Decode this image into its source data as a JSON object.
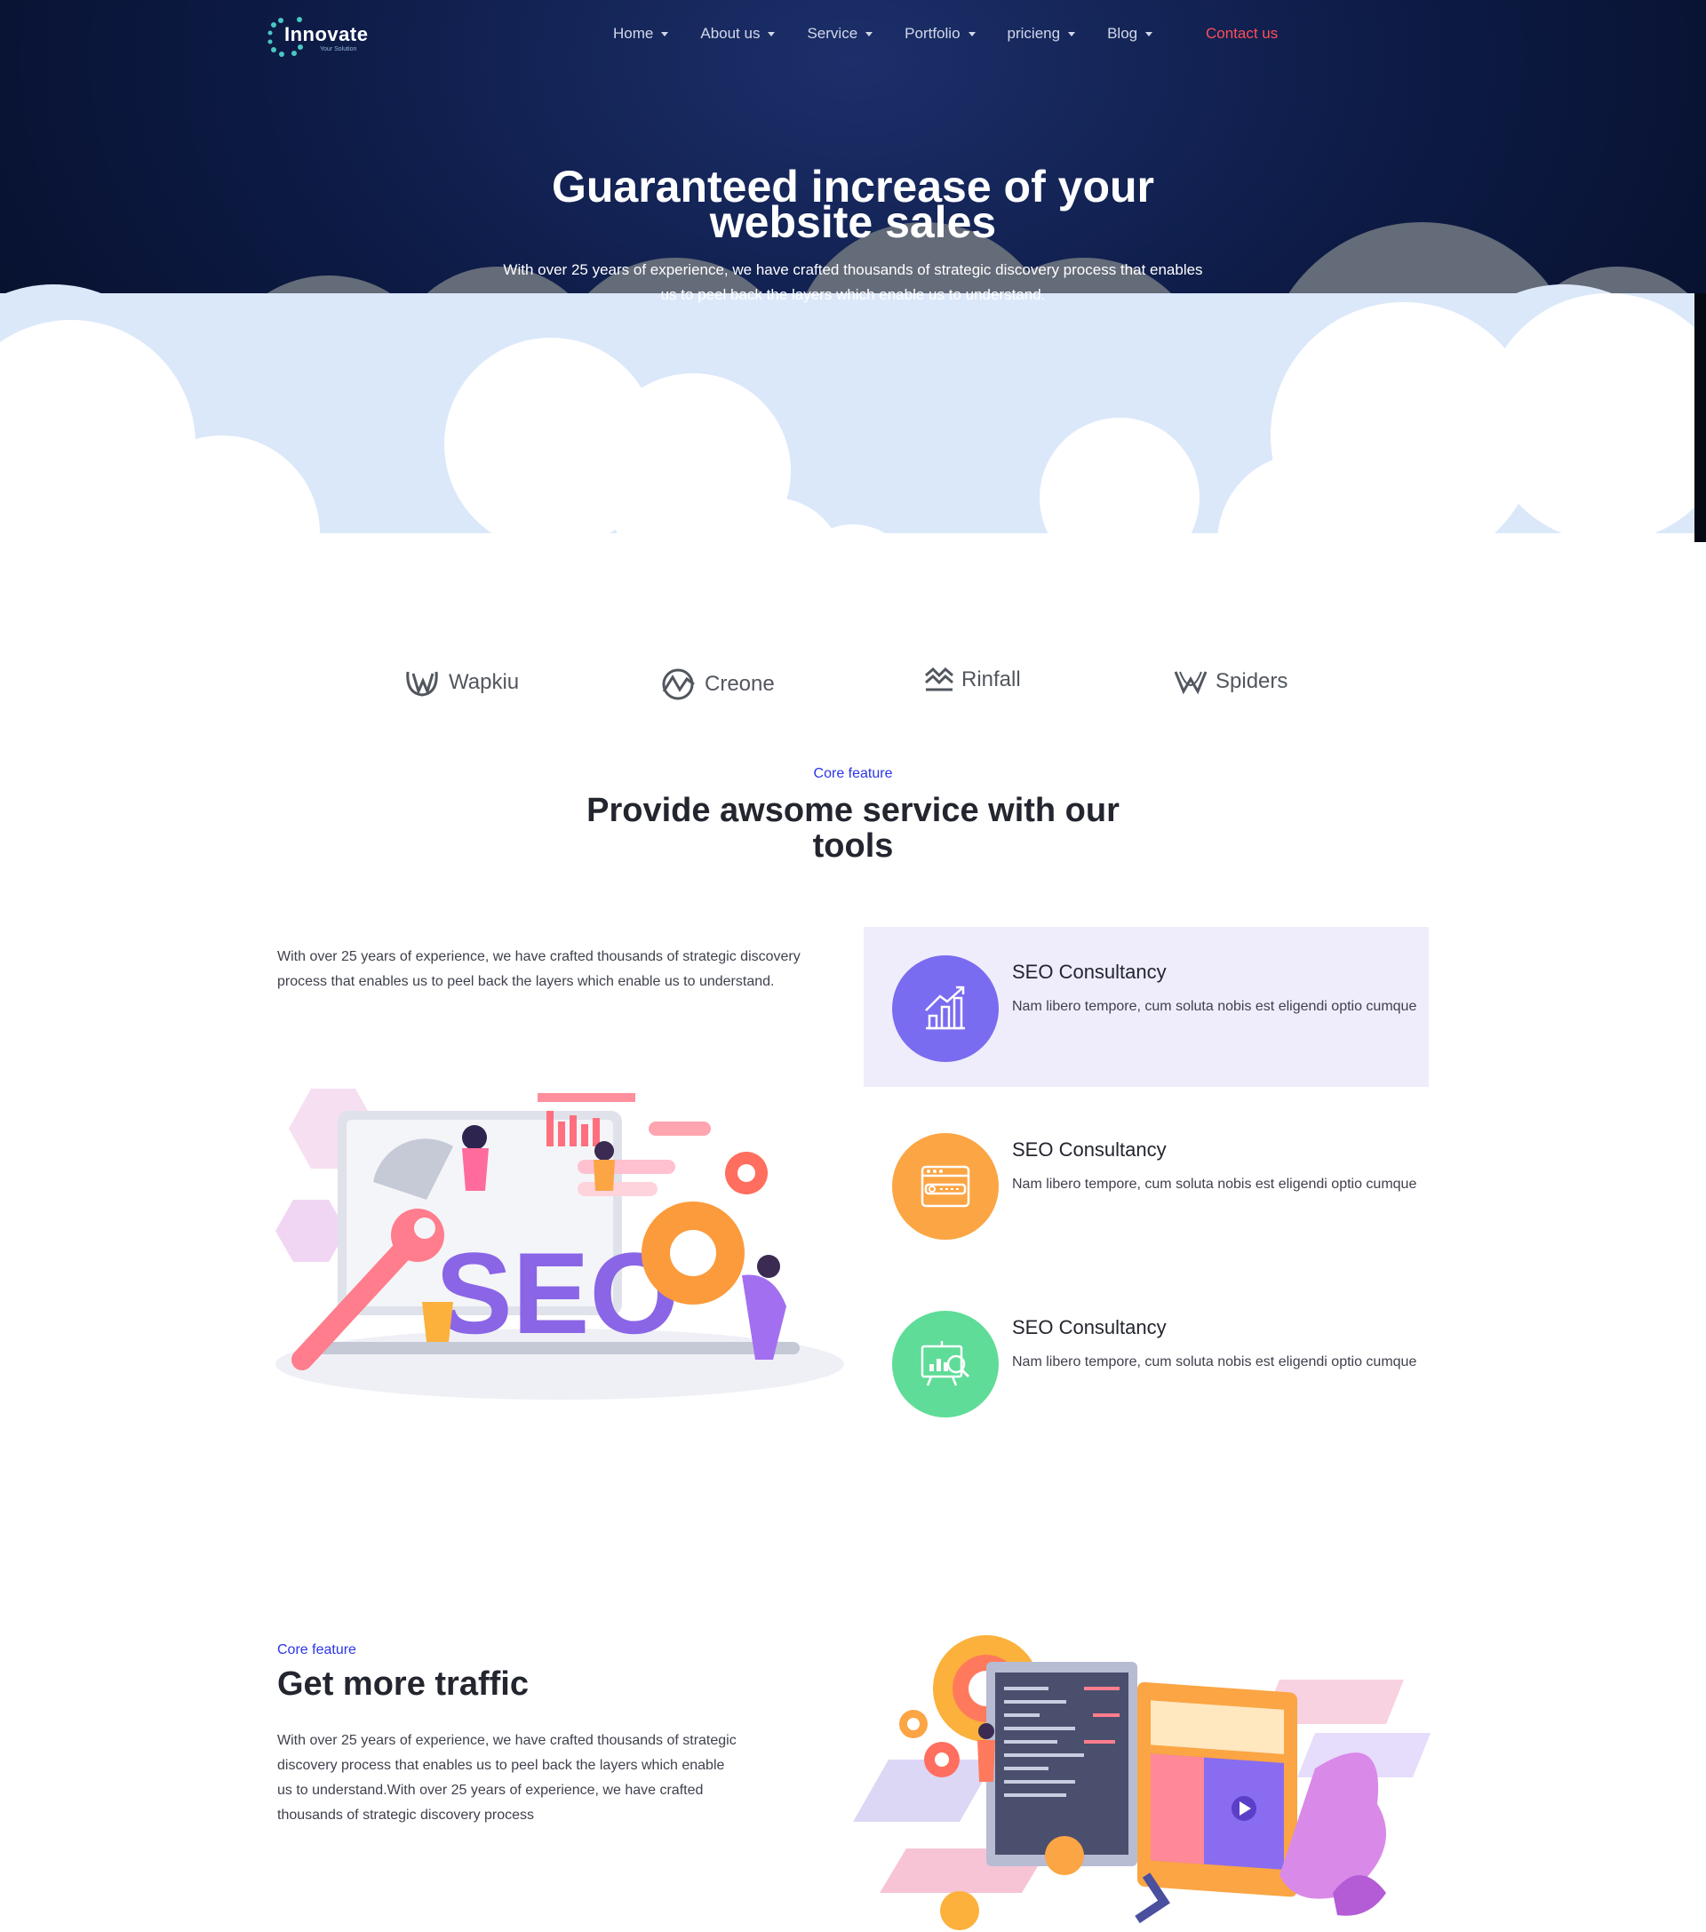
{
  "nav": {
    "logo_text": "Innovate",
    "logo_sub": "Your Solution",
    "items": [
      {
        "label": "Home"
      },
      {
        "label": "About us"
      },
      {
        "label": "Service"
      },
      {
        "label": "Portfolio"
      },
      {
        "label": "pricieng"
      },
      {
        "label": "Blog"
      }
    ],
    "contact": "Contact us"
  },
  "hero": {
    "title_line1": "Guaranteed increase of your",
    "title_line2": "website sales",
    "subtitle_line1": "With over 25 years of experience, we have crafted thousands of strategic discovery process that enables",
    "subtitle_line2": "us to peel back the layers which enable us to understand."
  },
  "brands": [
    {
      "name": "Wapkiu"
    },
    {
      "name": "Creone"
    },
    {
      "name": "Rinfall"
    },
    {
      "name": "Spiders"
    }
  ],
  "services": {
    "eyebrow": "Core feature",
    "title_line1": "Provide awsome service with our",
    "title_line2": "tools",
    "text": "With over 25 years of experience, we have crafted thousands of strategic discovery process that enables us to peel back the layers which enable us to understand.",
    "illustration_text": "SEO",
    "features": [
      {
        "title": "SEO Consultancy",
        "text": "Nam libero tempore, cum soluta nobis est eligendi optio cumque",
        "color": "#7a6cf0"
      },
      {
        "title": "SEO Consultancy",
        "text": "Nam libero tempore, cum soluta nobis est eligendi optio cumque",
        "color": "#fba544"
      },
      {
        "title": "SEO Consultancy",
        "text": "Nam libero tempore, cum soluta nobis est eligendi optio cumque",
        "color": "#5fdc98"
      }
    ]
  },
  "traffic": {
    "eyebrow": "Core feature",
    "title": "Get more traffic",
    "text": "With over 25 years of experience, we have crafted thousands of strategic discovery process that enables us to peel back the layers which enable us to understand.With over 25 years of experience, we have crafted thousands of strategic discovery process"
  },
  "colors": {
    "hero_dark": "#0d1b46",
    "accent_blue": "#2b35e6",
    "contact_red": "#ff4e58",
    "feature_active_bg": "#efedfc"
  }
}
